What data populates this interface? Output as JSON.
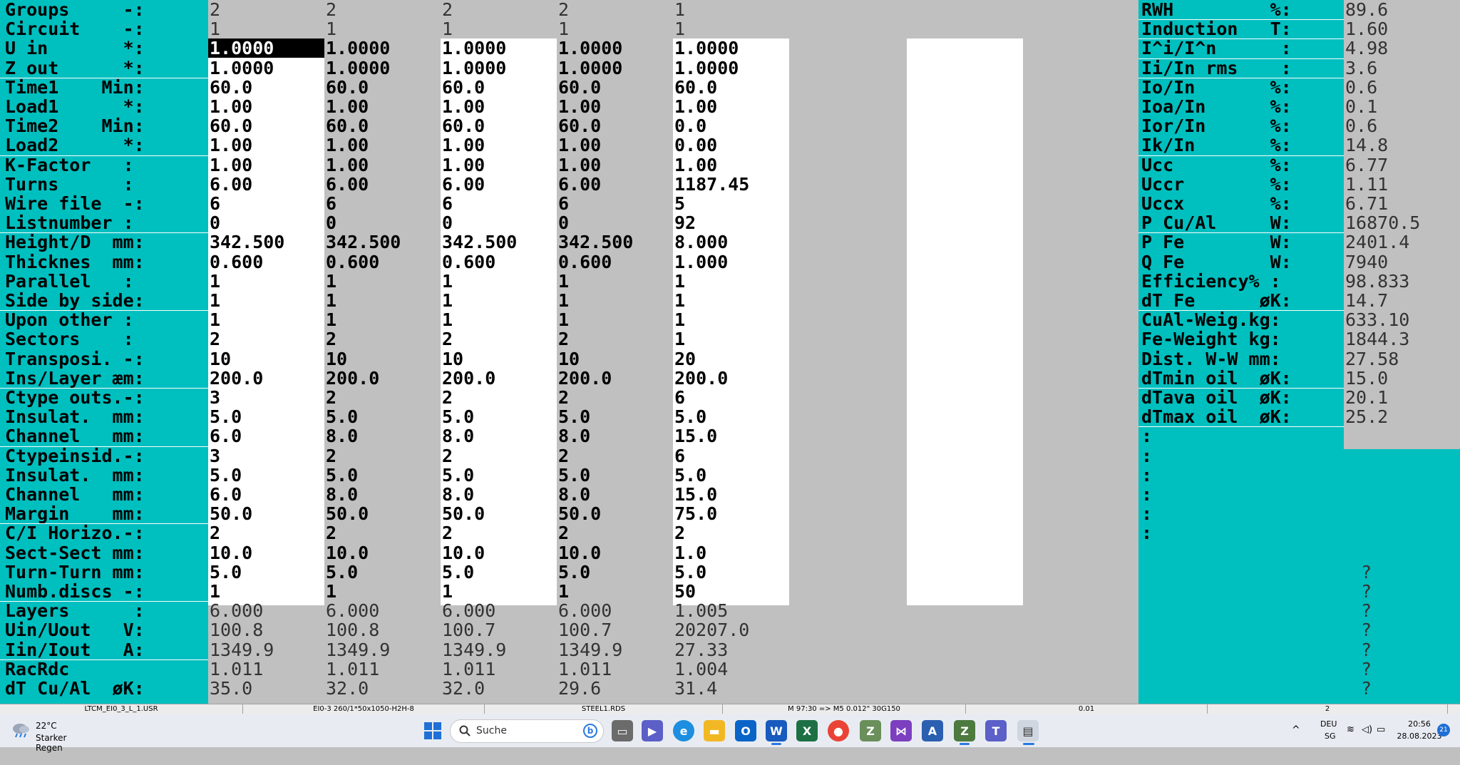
{
  "left_labels": [
    "Groups     -:",
    "Circuit    -:",
    "U in       *:",
    "Z out      *:",
    "Time1    Min:",
    "Load1      *:",
    "Time2    Min:",
    "Load2      *:",
    "K-Factor   :",
    "Turns      :",
    "Wire file  -:",
    "Listnumber :",
    "Height/D  mm:",
    "Thicknes  mm:",
    "Parallel   :",
    "Side by side:",
    "Upon other :",
    "Sectors    :",
    "Transposi. -:",
    "Ins/Layer æm:",
    "Ctype outs.-:",
    "Insulat.  mm:",
    "Channel   mm:",
    "Ctypeinsid.-:",
    "Insulat.  mm:",
    "Channel   mm:",
    "Margin    mm:",
    "C/I Horizo.-:",
    "Sect-Sect mm:",
    "Turn-Turn mm:",
    "Numb.discs -:",
    "Layers      :",
    "Uin/Uout   V:",
    "Iin/Iout   A:",
    "RacRdc",
    "dT Cu/Al  øK:"
  ],
  "columns": [
    [
      "2",
      "1",
      "1.0000",
      "1.0000",
      "60.0",
      "1.00",
      "60.0",
      "1.00",
      "1.00",
      "6.00",
      "6",
      "0",
      "342.500",
      "0.600",
      "1",
      "1",
      "1",
      "2",
      "10",
      "200.0",
      "3",
      "5.0",
      "6.0",
      "3",
      "5.0",
      "6.0",
      "50.0",
      "2",
      "10.0",
      "5.0",
      "1",
      "6.000",
      "100.8",
      "1349.9",
      "1.011",
      "35.0"
    ],
    [
      "2",
      "1",
      "1.0000",
      "1.0000",
      "60.0",
      "1.00",
      "60.0",
      "1.00",
      "1.00",
      "6.00",
      "6",
      "0",
      "342.500",
      "0.600",
      "1",
      "1",
      "1",
      "2",
      "10",
      "200.0",
      "2",
      "5.0",
      "8.0",
      "2",
      "5.0",
      "8.0",
      "50.0",
      "2",
      "10.0",
      "5.0",
      "1",
      "6.000",
      "100.8",
      "1349.9",
      "1.011",
      "32.0"
    ],
    [
      "2",
      "1",
      "1.0000",
      "1.0000",
      "60.0",
      "1.00",
      "60.0",
      "1.00",
      "1.00",
      "6.00",
      "6",
      "0",
      "342.500",
      "0.600",
      "1",
      "1",
      "1",
      "2",
      "10",
      "200.0",
      "2",
      "5.0",
      "8.0",
      "2",
      "5.0",
      "8.0",
      "50.0",
      "2",
      "10.0",
      "5.0",
      "1",
      "6.000",
      "100.7",
      "1349.9",
      "1.011",
      "32.0"
    ],
    [
      "2",
      "1",
      "1.0000",
      "1.0000",
      "60.0",
      "1.00",
      "60.0",
      "1.00",
      "1.00",
      "6.00",
      "6",
      "0",
      "342.500",
      "0.600",
      "1",
      "1",
      "1",
      "2",
      "10",
      "200.0",
      "2",
      "5.0",
      "8.0",
      "2",
      "5.0",
      "8.0",
      "50.0",
      "2",
      "10.0",
      "5.0",
      "1",
      "6.000",
      "100.7",
      "1349.9",
      "1.011",
      "29.6"
    ],
    [
      "1",
      "1",
      "1.0000",
      "1.0000",
      "60.0",
      "1.00",
      "0.0",
      "0.00",
      "1.00",
      "1187.45",
      "5",
      "92",
      "8.000",
      "1.000",
      "1",
      "1",
      "1",
      "1",
      "20",
      "200.0",
      "6",
      "5.0",
      "15.0",
      "6",
      "5.0",
      "15.0",
      "75.0",
      "2",
      "1.0",
      "5.0",
      "50",
      "1.005",
      "20207.0",
      "27.33",
      "1.004",
      "31.4"
    ]
  ],
  "right_labels": [
    "RWH         %:",
    "Induction   T:",
    "I^i/I^n      :",
    "Ii/In rms    :",
    "Io/In       %:",
    "Ioa/In      %:",
    "Ior/In      %:",
    "Ik/In       %:",
    "Ucc         %:",
    "Uccr        %:",
    "Uccx        %:",
    "P Cu/Al     W:",
    "P Fe        W:",
    "Q Fe        W:",
    "Efficiency% :",
    "dT Fe      øK:",
    "CuAl-Weig.kg:",
    "Fe-Weight kg:",
    "Dist. W-W mm:",
    "dTmin oil  øK:",
    "dTava oil  øK:",
    "dTmax oil  øK:",
    ":",
    ":",
    ":",
    ":",
    ":",
    ":",
    "",
    "",
    "",
    "",
    "",
    "",
    "",
    ""
  ],
  "right_values": [
    "89.6",
    "1.60",
    "4.98",
    "3.6",
    "0.6",
    "0.1",
    "0.6",
    "14.8",
    "6.77",
    "1.11",
    "6.71",
    "16870.5",
    "2401.4",
    "7940",
    "98.833",
    "14.7",
    "633.10",
    "1844.3",
    "27.58",
    "15.0",
    "20.1",
    "25.2",
    "",
    "",
    "",
    "",
    "",
    "",
    "",
    "?",
    "?",
    "?",
    "?",
    "?",
    "?",
    "?"
  ],
  "status_bar": [
    "LTCM_EI0_3_L_1.USR",
    "EI0-3 260/1*50x1050-H2H-8",
    "STEEL1.RDS",
    "M 97:30 => M5 0.012\" 30G150",
    "0.01",
    "2",
    ""
  ],
  "taskbar": {
    "weather_temp": "22°C",
    "weather_text": "Starker Regen",
    "search_placeholder": "Suche",
    "language": "DEU",
    "region": "SG",
    "time": "20:56",
    "date": "28.08.2023",
    "notification_count": "21"
  },
  "colors": {
    "label_bg": "#00bfbf",
    "window_bg": "#c0c0c0",
    "input_bg": "#ffffff",
    "selected_bg": "#000000"
  }
}
